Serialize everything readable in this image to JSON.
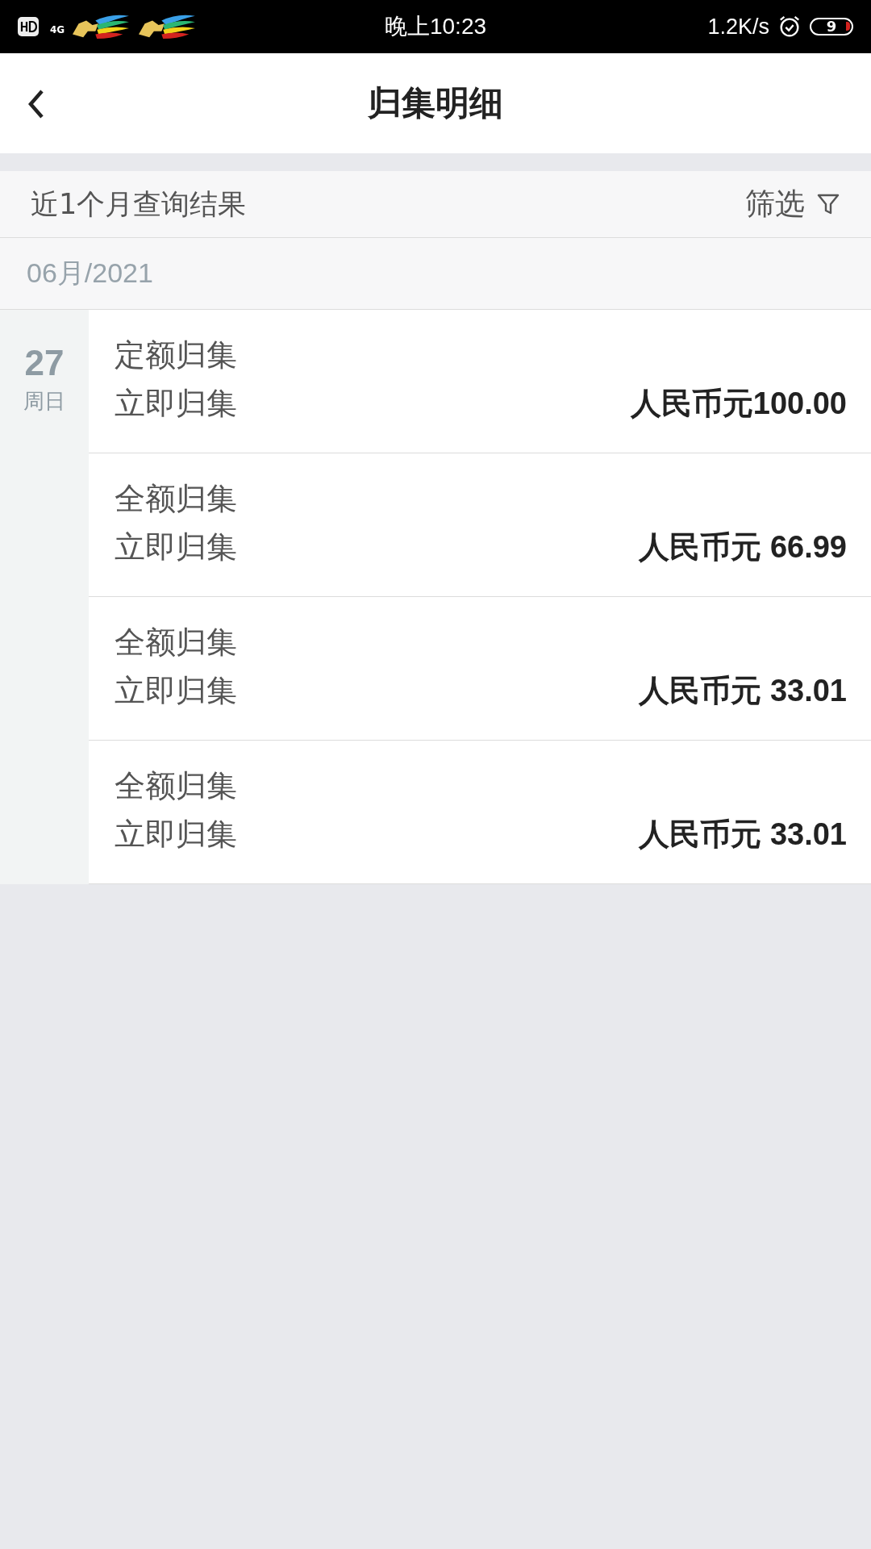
{
  "status_bar": {
    "network": "4G",
    "time": "晚上10:23",
    "speed": "1.2K/s",
    "battery": "9"
  },
  "header": {
    "title": "归集明细"
  },
  "filter_bar": {
    "summary": "近1个月查询结果",
    "filter_label": "筛选"
  },
  "month": "06月/2021",
  "days": [
    {
      "day": "27",
      "weekday": "周日",
      "records": [
        {
          "type": "定额归集",
          "mode": "立即归集",
          "amount": "人民币元100.00"
        },
        {
          "type": "全额归集",
          "mode": "立即归集",
          "amount": "人民币元 66.99"
        },
        {
          "type": "全额归集",
          "mode": "立即归集",
          "amount": "人民币元 33.01"
        },
        {
          "type": "全额归集",
          "mode": "立即归集",
          "amount": "人民币元 33.01"
        }
      ]
    }
  ]
}
